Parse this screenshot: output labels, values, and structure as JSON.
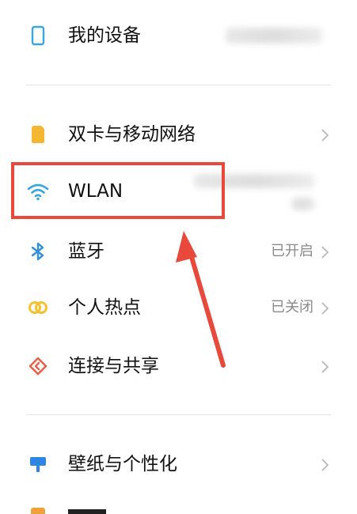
{
  "rows": {
    "my_device": {
      "label": "我的设备",
      "icon": "phone-icon"
    },
    "dual_sim": {
      "label": "双卡与移动网络",
      "icon": "sim-card-icon"
    },
    "wlan": {
      "label": "WLAN",
      "icon": "wifi-icon"
    },
    "bluetooth": {
      "label": "蓝牙",
      "value": "已开启",
      "icon": "bluetooth-icon"
    },
    "hotspot": {
      "label": "个人热点",
      "value": "已关闭",
      "icon": "hotspot-icon"
    },
    "share": {
      "label": "连接与共享",
      "icon": "share-icon"
    },
    "wallpaper": {
      "label": "壁纸与个性化",
      "icon": "wallpaper-icon"
    }
  },
  "colors": {
    "annotation": "#e8493b",
    "phone_icon": "#3aa6e0",
    "sim_icon": "#f5b731",
    "wifi_icon": "#3aa6e0",
    "bluetooth_icon": "#2f8fe0",
    "hotspot_icon": "#f2c230",
    "share_icon": "#e8604a",
    "wallpaper_icon": "#2f86e0"
  }
}
